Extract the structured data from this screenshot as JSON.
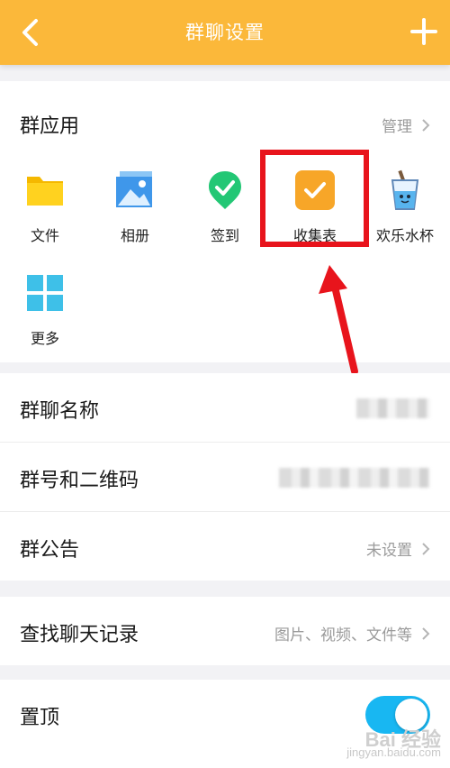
{
  "header": {
    "title": "群聊设置",
    "bg_color": "#fbb83a",
    "back_icon": "chevron-left-icon",
    "add_icon": "plus-icon"
  },
  "apps": {
    "title": "群应用",
    "manage_label": "管理",
    "items": [
      {
        "label": "文件",
        "icon": "folder-icon"
      },
      {
        "label": "相册",
        "icon": "photo-album-icon"
      },
      {
        "label": "签到",
        "icon": "check-in-pin-icon"
      },
      {
        "label": "收集表",
        "icon": "collection-form-icon"
      },
      {
        "label": "欢乐水杯",
        "icon": "water-cup-icon"
      },
      {
        "label": "更多",
        "icon": "more-grid-icon"
      }
    ]
  },
  "settings": {
    "group_name_label": "群聊名称",
    "group_id_label": "群号和二维码",
    "announcement_label": "群公告",
    "announcement_value": "未设置",
    "search_history_label": "查找聊天记录",
    "search_history_value": "图片、视频、文件等",
    "pin_label": "置顶",
    "pin_on": true
  },
  "watermark": {
    "brand": "Bai 经验",
    "url": "jingyan.baidu.com"
  },
  "colors": {
    "accent": "#fbb83a",
    "highlight": "#e8141c",
    "toggle_on": "#18b7f2"
  }
}
